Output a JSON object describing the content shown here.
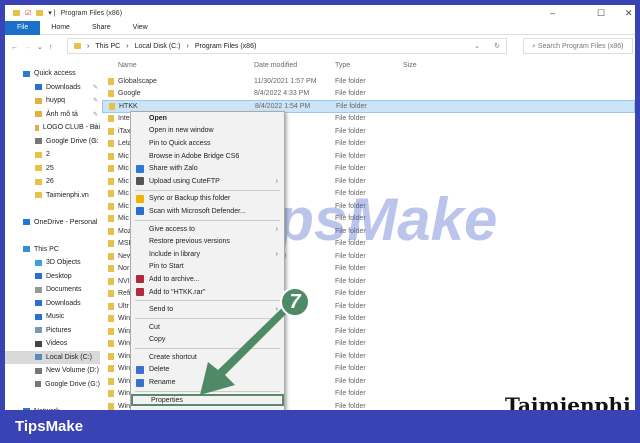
{
  "window": {
    "title": "Program Files (x86)",
    "min": "–",
    "max": "☐",
    "close": "✕"
  },
  "ribbon": {
    "file": "File",
    "home": "Home",
    "share": "Share",
    "view": "View"
  },
  "address": {
    "crumbs": [
      "This PC",
      "Local Disk (C:)",
      "Program Files (x86)"
    ],
    "search_placeholder": "Search Program Files (x86)"
  },
  "columns": {
    "name": "Name",
    "date": "Date modified",
    "type": "Type",
    "size": "Size"
  },
  "sidebar": [
    {
      "label": "Quick access",
      "indent": 0,
      "color": "#2a7ad5",
      "pin": false
    },
    {
      "label": "Downloads",
      "indent": 1,
      "color": "#2a6fd0",
      "pin": true
    },
    {
      "label": "huypq",
      "indent": 1,
      "color": "#e0b040",
      "pin": true
    },
    {
      "label": "Ảnh mô tả",
      "indent": 1,
      "color": "#e0b040",
      "pin": true
    },
    {
      "label": "LOGO CLUB - Bài",
      "indent": 1,
      "color": "#e0b040",
      "pin": true
    },
    {
      "label": "Google Drive (G:",
      "indent": 1,
      "color": "#777",
      "pin": true
    },
    {
      "label": "2",
      "indent": 1,
      "color": "#e8c14a",
      "pin": false
    },
    {
      "label": "25",
      "indent": 1,
      "color": "#e8c14a",
      "pin": false
    },
    {
      "label": "26",
      "indent": 1,
      "color": "#e8c14a",
      "pin": false
    },
    {
      "label": "Taimienphi.vn",
      "indent": 1,
      "color": "#e8c14a",
      "pin": false
    },
    {
      "label": "",
      "indent": 0,
      "color": "",
      "pin": false
    },
    {
      "label": "OneDrive - Personal",
      "indent": 0,
      "color": "#1e78d4",
      "pin": false
    },
    {
      "label": "",
      "indent": 0,
      "color": "",
      "pin": false
    },
    {
      "label": "This PC",
      "indent": 0,
      "color": "#3a8ad6",
      "pin": false
    },
    {
      "label": "3D Objects",
      "indent": 1,
      "color": "#3aa0e0",
      "pin": false
    },
    {
      "label": "Desktop",
      "indent": 1,
      "color": "#2a6fd0",
      "pin": false
    },
    {
      "label": "Documents",
      "indent": 1,
      "color": "#999",
      "pin": false
    },
    {
      "label": "Downloads",
      "indent": 1,
      "color": "#2a6fd0",
      "pin": false
    },
    {
      "label": "Music",
      "indent": 1,
      "color": "#2a6fd0",
      "pin": false
    },
    {
      "label": "Pictures",
      "indent": 1,
      "color": "#7a9ab0",
      "pin": false
    },
    {
      "label": "Videos",
      "indent": 1,
      "color": "#444",
      "pin": false
    },
    {
      "label": "Local Disk (C:)",
      "indent": 1,
      "color": "#5a8ac0",
      "pin": false,
      "selected": true
    },
    {
      "label": "New Volume (D:)",
      "indent": 1,
      "color": "#777",
      "pin": false
    },
    {
      "label": "Google Drive (G:)",
      "indent": 1,
      "color": "#777",
      "pin": false
    },
    {
      "label": "",
      "indent": 0,
      "color": "",
      "pin": false
    },
    {
      "label": "Network",
      "indent": 0,
      "color": "#2a7ad5",
      "pin": false
    }
  ],
  "files": [
    {
      "name": "Globalscape",
      "date": "11/30/2021 1:57 PM",
      "type": "File folder"
    },
    {
      "name": "Google",
      "date": "8/4/2022 4:33 PM",
      "type": "File folder"
    },
    {
      "name": "HTKK",
      "date": "8/4/2022 1:54 PM",
      "type": "File folder",
      "selected": true
    },
    {
      "name": "Inte",
      "date": "5:34 PM",
      "type": "File folder"
    },
    {
      "name": "iTax",
      "date": "4:19 PM",
      "type": "File folder"
    },
    {
      "name": "Leta",
      "date": "2:12 PM",
      "type": "File folder"
    },
    {
      "name": "Mic",
      "date": "10:08 AM",
      "type": "File folder"
    },
    {
      "name": "Mic",
      "date": "5:04 PM",
      "type": "File folder"
    },
    {
      "name": "Mic",
      "date": "33 PM",
      "type": "File folder"
    },
    {
      "name": "Mic",
      "date": "5:04 PM",
      "type": "File folder"
    },
    {
      "name": "Mic",
      "date": "5:05 PM",
      "type": "File folder"
    },
    {
      "name": "Mic",
      "date": "5:05 PM",
      "type": "File folder"
    },
    {
      "name": "Moz",
      "date": "5:05 PM",
      "type": "File folder"
    },
    {
      "name": "MSE",
      "date": "11:26 PM",
      "type": "File folder"
    },
    {
      "name": "New",
      "date": "1 4:42 PM",
      "type": "File folder"
    },
    {
      "name": "Nor",
      "date": "4:47 PM",
      "type": "File folder"
    },
    {
      "name": "NVI",
      "date": "10:22 AM",
      "type": "File folder"
    },
    {
      "name": "Refi",
      "date": "PM",
      "type": "File folder"
    },
    {
      "name": "Ultr",
      "date": "",
      "type": "File folder"
    },
    {
      "name": "Win",
      "date": "PM",
      "type": "File folder"
    },
    {
      "name": "Win",
      "date": "33 PM",
      "type": "File folder"
    },
    {
      "name": "Win",
      "date": "6:00 PM",
      "type": "File folder"
    },
    {
      "name": "Win",
      "date": "5:50 PM",
      "type": "File folder"
    },
    {
      "name": "Win",
      "date": "4:54 PM",
      "type": "File folder"
    },
    {
      "name": "Win",
      "date": "4:50 PM",
      "type": "File folder"
    },
    {
      "name": "Win",
      "date": "11:43 PM",
      "type": "File folder"
    },
    {
      "name": "Win",
      "date": "4:54 PM",
      "type": "File folder"
    }
  ],
  "context_menu": [
    {
      "label": "Open",
      "bold": true
    },
    {
      "label": "Open in new window"
    },
    {
      "label": "Pin to Quick access"
    },
    {
      "label": "Browse in Adobe Bridge CS6"
    },
    {
      "label": "Share with Zalo",
      "icon": "#2a7ad5"
    },
    {
      "label": "Upload using CuteFTP",
      "icon": "#555",
      "sub": true
    },
    {
      "sep": true
    },
    {
      "label": "Sync or Backup this folder",
      "icon": "#f0b400"
    },
    {
      "label": "Scan with Microsoft Defender...",
      "icon": "#2a6fd0"
    },
    {
      "sep": true
    },
    {
      "label": "Give access to",
      "sub": true
    },
    {
      "label": "Restore previous versions"
    },
    {
      "label": "Include in library",
      "sub": true
    },
    {
      "label": "Pin to Start"
    },
    {
      "label": "Add to archive...",
      "icon": "#b02a40"
    },
    {
      "label": "Add to \"HTKK.rar\"",
      "icon": "#b02a40"
    },
    {
      "sep": true
    },
    {
      "label": "Send to",
      "sub": true
    },
    {
      "sep": true
    },
    {
      "label": "Cut"
    },
    {
      "label": "Copy"
    },
    {
      "sep": true
    },
    {
      "label": "Create shortcut"
    },
    {
      "label": "Delete",
      "icon": "#3a6fd0"
    },
    {
      "label": "Rename",
      "icon": "#3a6fd0"
    },
    {
      "sep": true
    },
    {
      "label": "Properties",
      "highlight": true
    }
  ],
  "step_badge": "7",
  "watermark": "TipsMake",
  "watermark2": "Taimienphi",
  "banner": "TipsMake"
}
